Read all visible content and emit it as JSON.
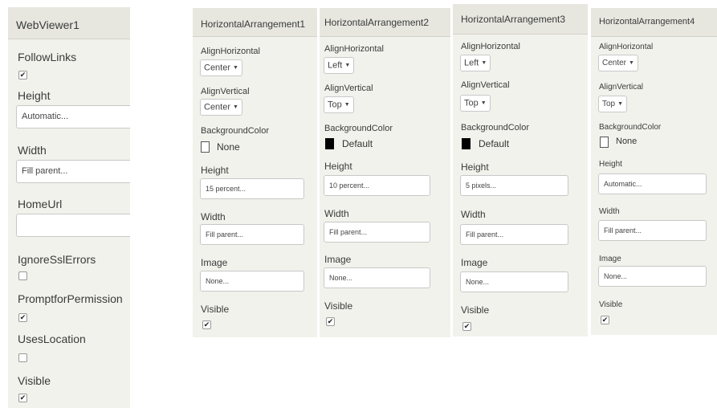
{
  "webviewer": {
    "title": "WebViewer1",
    "follow_links": {
      "label": "FollowLinks",
      "checked": true
    },
    "height": {
      "label": "Height",
      "value": "Automatic..."
    },
    "width": {
      "label": "Width",
      "value": "Fill parent..."
    },
    "home_url": {
      "label": "HomeUrl",
      "value": ""
    },
    "ignore_ssl_errors": {
      "label": "IgnoreSslErrors",
      "checked": false
    },
    "prompt_for_permission": {
      "label": "PromptforPermission",
      "checked": true
    },
    "uses_location": {
      "label": "UsesLocation",
      "checked": false
    },
    "visible": {
      "label": "Visible",
      "checked": true
    }
  },
  "arrangements": [
    {
      "title": "HorizontalArrangement1",
      "align_horizontal": {
        "label": "AlignHorizontal",
        "value": "Center"
      },
      "align_vertical": {
        "label": "AlignVertical",
        "value": "Center"
      },
      "background_color": {
        "label": "BackgroundColor",
        "value": "None",
        "swatch": "#ffffff"
      },
      "height": {
        "label": "Height",
        "value": "15 percent..."
      },
      "width": {
        "label": "Width",
        "value": "Fill parent..."
      },
      "image": {
        "label": "Image",
        "value": "None..."
      },
      "visible": {
        "label": "Visible",
        "checked": true
      }
    },
    {
      "title": "HorizontalArrangement2",
      "align_horizontal": {
        "label": "AlignHorizontal",
        "value": "Left"
      },
      "align_vertical": {
        "label": "AlignVertical",
        "value": "Top"
      },
      "background_color": {
        "label": "BackgroundColor",
        "value": "Default",
        "swatch": "#000000"
      },
      "height": {
        "label": "Height",
        "value": "10 percent..."
      },
      "width": {
        "label": "Width",
        "value": "Fill parent..."
      },
      "image": {
        "label": "Image",
        "value": "None..."
      },
      "visible": {
        "label": "Visible",
        "checked": true
      }
    },
    {
      "title": "HorizontalArrangement3",
      "align_horizontal": {
        "label": "AlignHorizontal",
        "value": "Left"
      },
      "align_vertical": {
        "label": "AlignVertical",
        "value": "Top"
      },
      "background_color": {
        "label": "BackgroundColor",
        "value": "Default",
        "swatch": "#000000"
      },
      "height": {
        "label": "Height",
        "value": "5 pixels..."
      },
      "width": {
        "label": "Width",
        "value": "Fill parent..."
      },
      "image": {
        "label": "Image",
        "value": "None..."
      },
      "visible": {
        "label": "Visible",
        "checked": true
      }
    },
    {
      "title": "HorizontalArrangement4",
      "align_horizontal": {
        "label": "AlignHorizontal",
        "value": "Center"
      },
      "align_vertical": {
        "label": "AlignVertical",
        "value": "Top"
      },
      "background_color": {
        "label": "BackgroundColor",
        "value": "None",
        "swatch": "#ffffff"
      },
      "height": {
        "label": "Height",
        "value": "Automatic..."
      },
      "width": {
        "label": "Width",
        "value": "Fill parent..."
      },
      "image": {
        "label": "Image",
        "value": "None..."
      },
      "visible": {
        "label": "Visible",
        "checked": true
      }
    }
  ]
}
